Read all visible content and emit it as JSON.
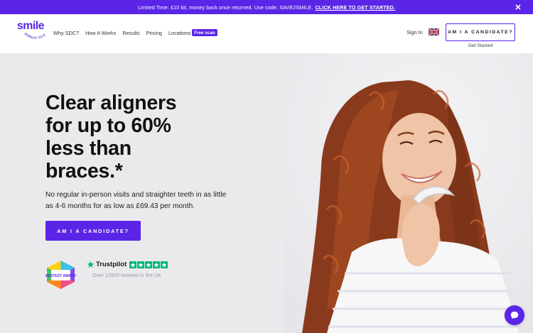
{
  "promo": {
    "text": "Limited Time: £10 kit, money back once returned. Use code: SAVE2SMILE.",
    "link": "CLICK HERE TO GET STARTED."
  },
  "header": {
    "logo_word": "smile",
    "logo_sub": "DIRECT CLUB",
    "nav": [
      {
        "label": "Why SDC?"
      },
      {
        "label": "How It Works"
      },
      {
        "label": "Results"
      },
      {
        "label": "Pricing"
      },
      {
        "label": "Locations"
      }
    ],
    "locations_badge": "Free scan",
    "sign_in": "Sign In",
    "cta": "AM I A CANDIDATE?",
    "get_started": "Get Started",
    "flag_icon": "uk-flag-icon"
  },
  "hero": {
    "headline_lines": [
      "Clear aligners",
      "for up to 60%",
      "less than",
      "braces.*"
    ],
    "subcopy": "No regular in-person visits and straighter teeth in as little as 4-6 months for as low as £69.43 per month.",
    "cta": "AM I A CANDIDATE?",
    "award_text": "BESTEST AWARD",
    "trustpilot": {
      "brand": "Trustpilot",
      "stars": 5,
      "reviews": "Over 12800 reviews in the UK"
    }
  },
  "colors": {
    "brand": "#5b25e8",
    "hero_bg": "#eaeaed",
    "trustpilot_green": "#00b67a"
  },
  "chat": {
    "icon": "chat-bubble-icon"
  }
}
